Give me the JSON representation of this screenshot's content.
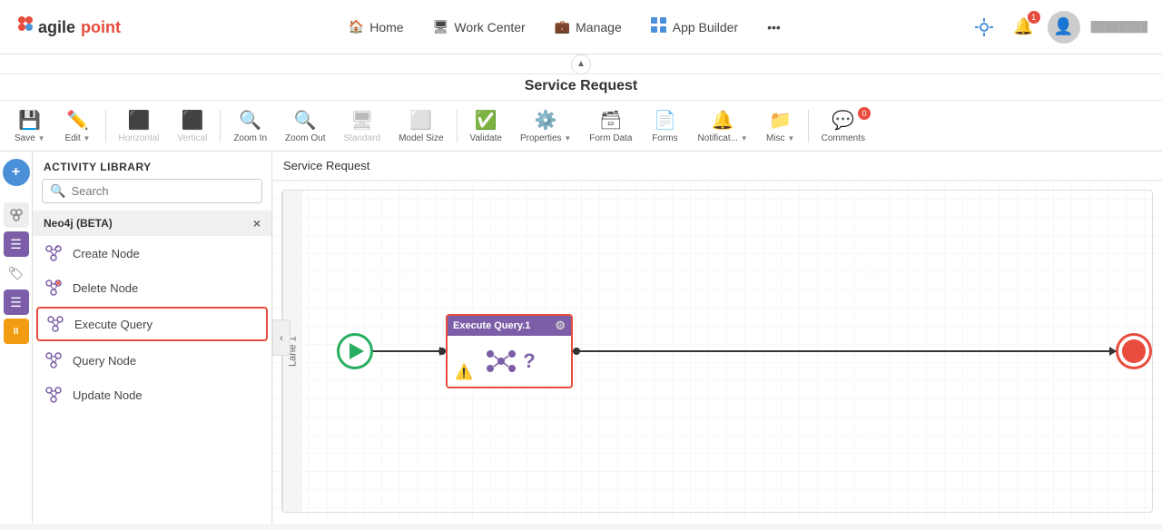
{
  "app": {
    "logo": "agilepoint",
    "logo_agile": "agile",
    "logo_point": "point"
  },
  "nav": {
    "home_label": "Home",
    "work_center_label": "Work Center",
    "manage_label": "Manage",
    "app_builder_label": "App Builder",
    "more_icon": "•••",
    "notification_badge": "1",
    "comments_badge": "0"
  },
  "page_title": "Service Request",
  "toolbar": {
    "save_label": "Save",
    "edit_label": "Edit",
    "horizontal_label": "Horizontal",
    "vertical_label": "Vertical",
    "zoom_in_label": "Zoom In",
    "zoom_out_label": "Zoom Out",
    "standard_label": "Standard",
    "model_size_label": "Model Size",
    "validate_label": "Validate",
    "properties_label": "Properties",
    "form_data_label": "Form Data",
    "forms_label": "Forms",
    "notifications_label": "Notificat...",
    "misc_label": "Misc",
    "comments_label": "Comments"
  },
  "activity_library": {
    "title": "ACTIVITY LIBRARY",
    "search_placeholder": "Search",
    "group": {
      "name": "Neo4j (BETA)",
      "close_icon": "×"
    },
    "items": [
      {
        "label": "Create Node",
        "icon": "⚙"
      },
      {
        "label": "Delete Node",
        "icon": "⚙"
      },
      {
        "label": "Execute Query",
        "icon": "⚙",
        "selected": true
      },
      {
        "label": "Query Node",
        "icon": "⚙"
      },
      {
        "label": "Update Node",
        "icon": "⚙"
      }
    ]
  },
  "canvas": {
    "title": "Service Request",
    "lane_label": "Lane 1",
    "workflow": {
      "node_title": "Execute Query.1",
      "node_gear": "⚙"
    }
  }
}
